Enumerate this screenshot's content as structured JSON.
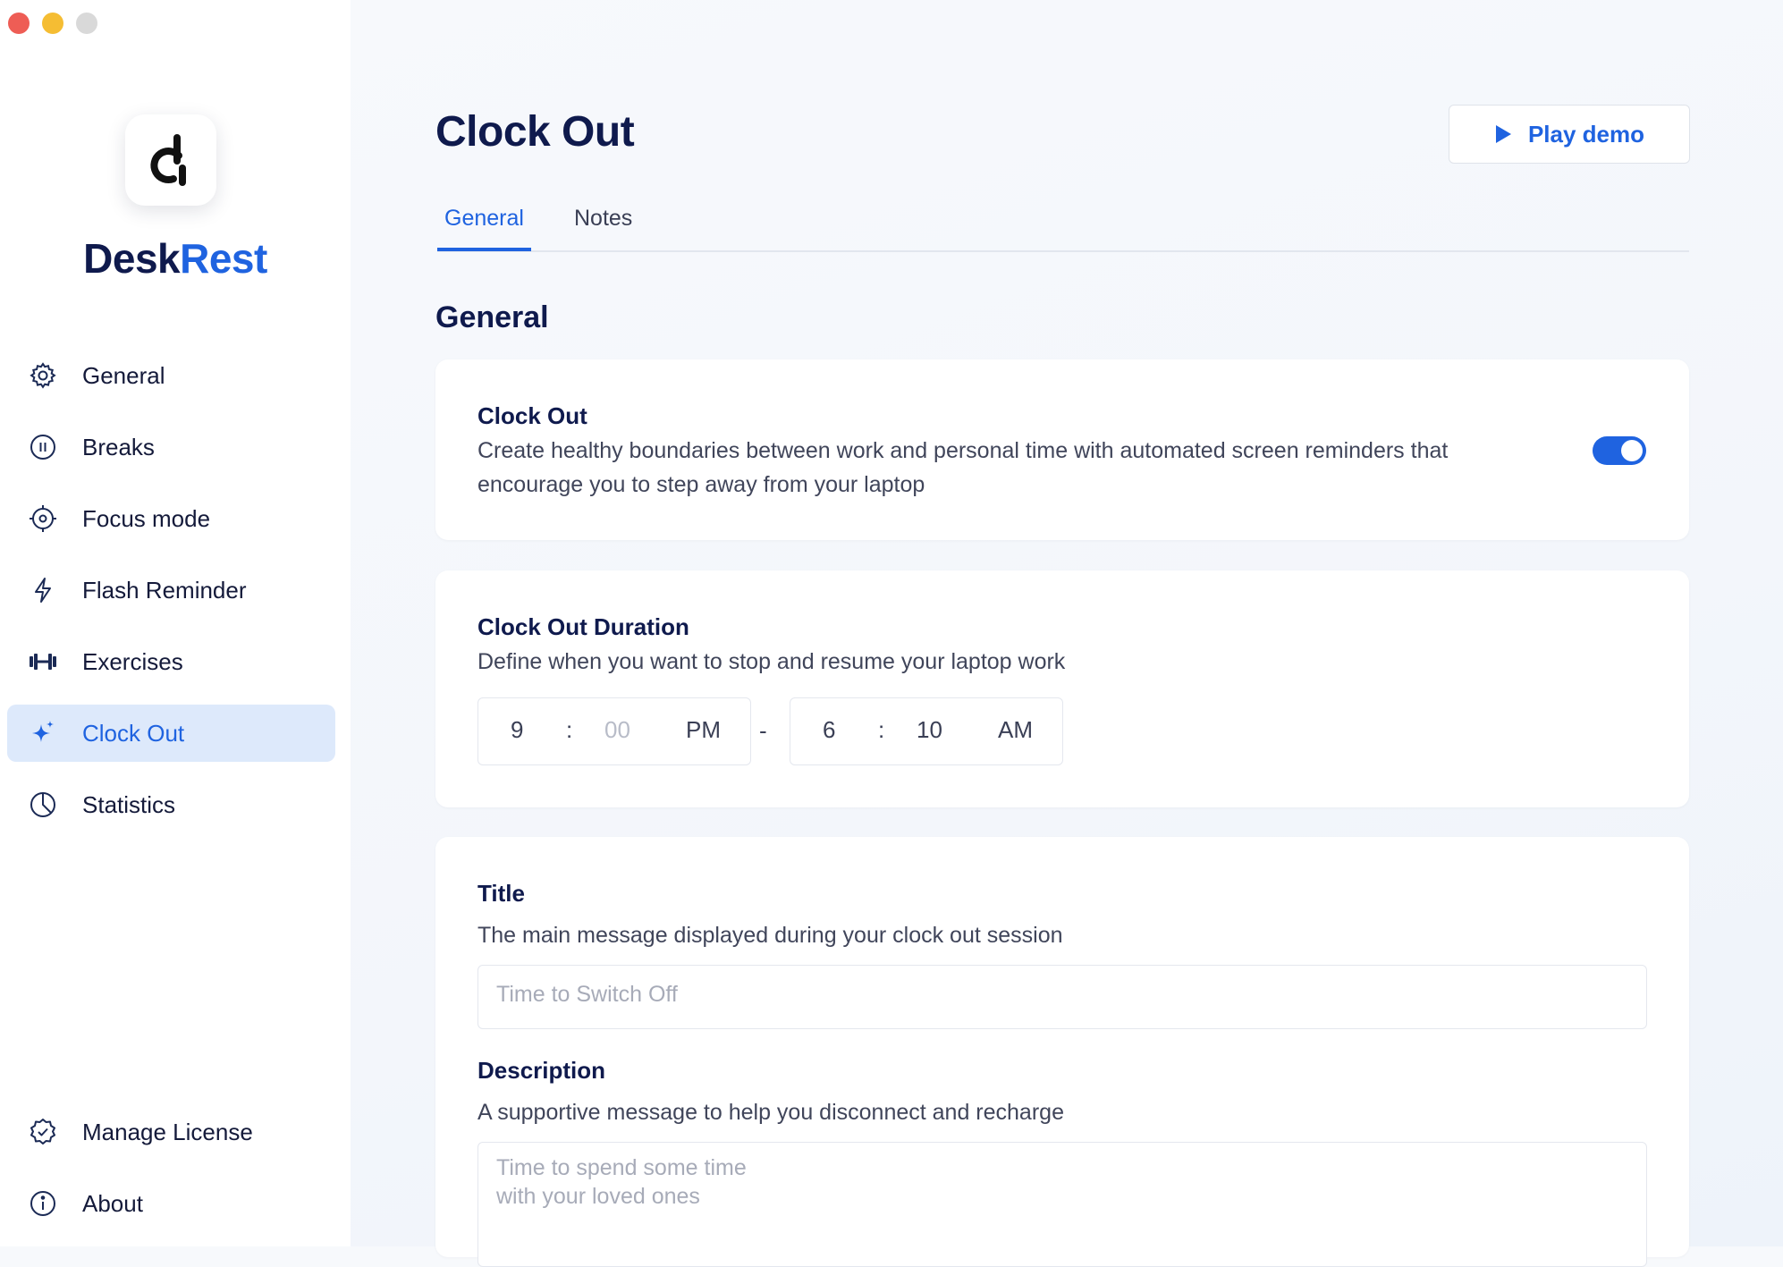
{
  "app": {
    "brand_part1": "Desk",
    "brand_part2": "Rest",
    "accent_color": "#1f63e0",
    "active_bg": "#dde9fb"
  },
  "sidebar": {
    "items": [
      {
        "label": "General",
        "icon": "gear-icon",
        "active": false
      },
      {
        "label": "Breaks",
        "icon": "pause-circle-icon",
        "active": false
      },
      {
        "label": "Focus mode",
        "icon": "target-icon",
        "active": false
      },
      {
        "label": "Flash Reminder",
        "icon": "lightning-icon",
        "active": false
      },
      {
        "label": "Exercises",
        "icon": "dumbbell-icon",
        "active": false
      },
      {
        "label": "Clock Out",
        "icon": "sparkle-icon",
        "active": true
      },
      {
        "label": "Statistics",
        "icon": "pie-chart-icon",
        "active": false
      }
    ],
    "bottom_items": [
      {
        "label": "Manage License",
        "icon": "badge-check-icon"
      },
      {
        "label": "About",
        "icon": "info-icon"
      }
    ]
  },
  "header": {
    "title": "Clock Out",
    "play_demo_label": "Play demo"
  },
  "tabs": [
    {
      "label": "General",
      "active": true
    },
    {
      "label": "Notes",
      "active": false
    }
  ],
  "section": {
    "title": "General"
  },
  "clock_out_card": {
    "title": "Clock Out",
    "description": "Create healthy boundaries between work and personal time with automated screen reminders that encourage you to step away from your laptop",
    "enabled": true
  },
  "duration_card": {
    "title": "Clock Out Duration",
    "description": "Define when you want to stop and resume your laptop work",
    "start": {
      "hour": "9",
      "sep": ":",
      "minute": "00",
      "period": "PM"
    },
    "range_sep": "-",
    "end": {
      "hour": "6",
      "sep": ":",
      "minute": "10",
      "period": "AM"
    }
  },
  "message_card": {
    "title_label": "Title",
    "title_help": "The main message displayed during your clock out session",
    "title_placeholder": "Time to Switch Off",
    "description_label": "Description",
    "description_help": "A supportive message to help you disconnect and recharge",
    "description_placeholder": "Time to spend some time\nwith your loved ones"
  }
}
